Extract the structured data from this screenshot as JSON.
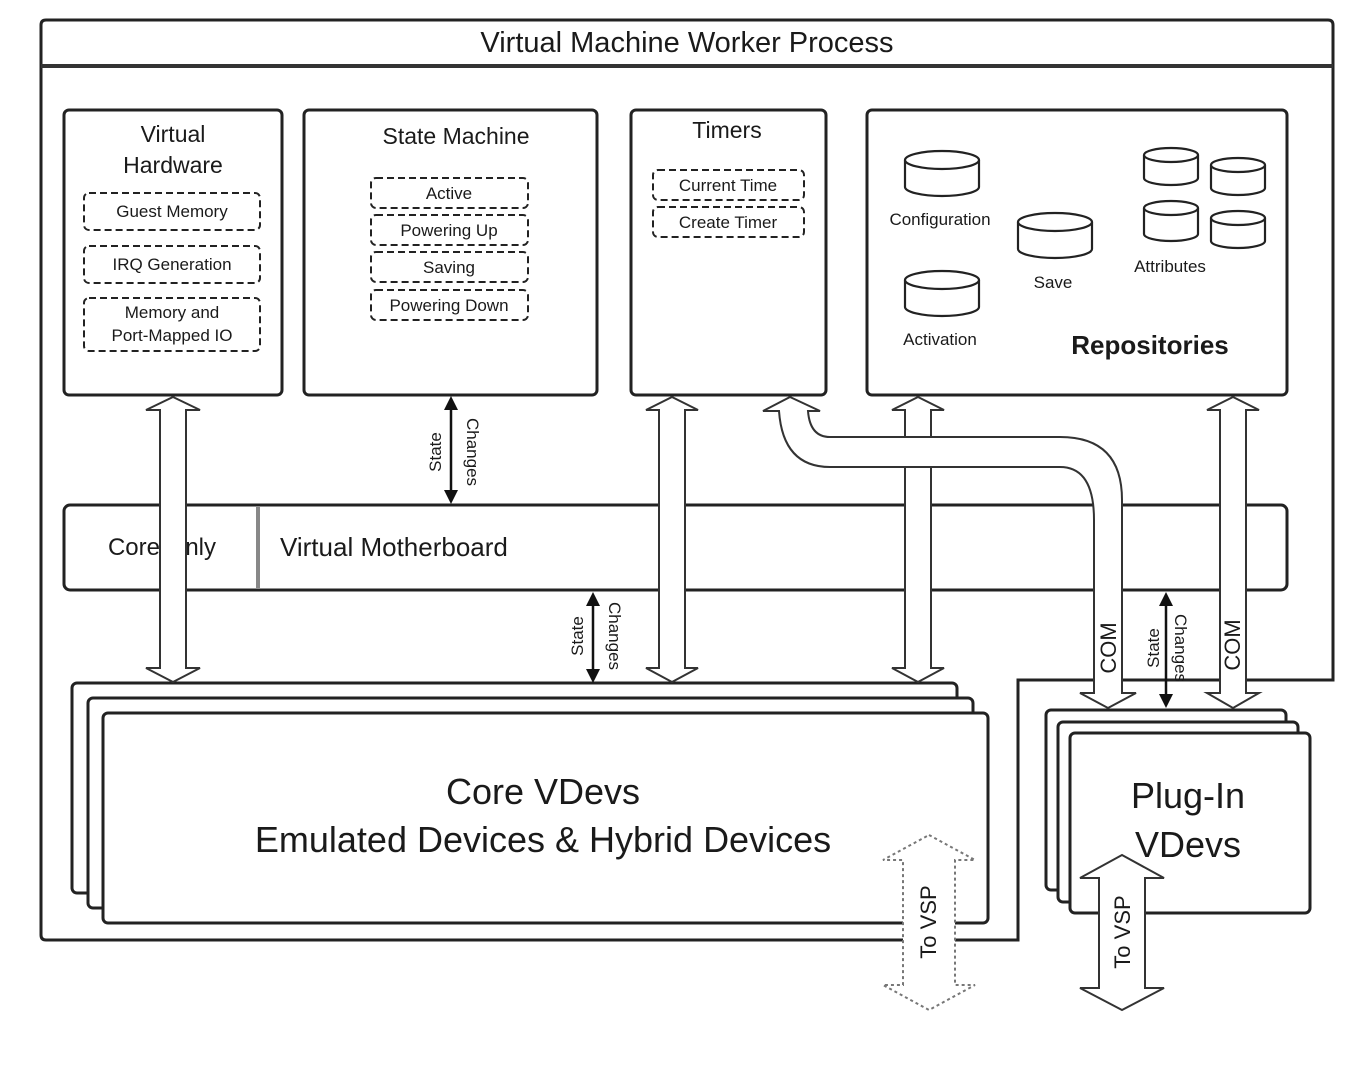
{
  "title": "Virtual Machine Worker Process",
  "virtual_hardware": {
    "title_line1": "Virtual",
    "title_line2": "Hardware",
    "items": [
      "Guest Memory",
      "IRQ Generation",
      "Memory and",
      "Port-Mapped IO"
    ]
  },
  "state_machine": {
    "title": "State Machine",
    "items": [
      "Active",
      "Powering Up",
      "Saving",
      "Powering Down"
    ]
  },
  "timers": {
    "title": "Timers",
    "items": [
      "Current Time",
      "Create Timer"
    ]
  },
  "repositories": {
    "title": "Repositories",
    "items": [
      "Configuration",
      "Save",
      "Attributes",
      "Activation"
    ]
  },
  "motherboard": {
    "core_only": "Core Only",
    "label": "Virtual Motherboard"
  },
  "connectors": {
    "state_label": "State",
    "changes_label": "Changes",
    "com_label": "COM",
    "to_vsp_label": "To VSP"
  },
  "core_vdevs": {
    "line1": "Core VDevs",
    "line2": "Emulated Devices & Hybrid Devices"
  },
  "plugin_vdevs": {
    "line1": "Plug-In",
    "line2": "VDevs"
  }
}
